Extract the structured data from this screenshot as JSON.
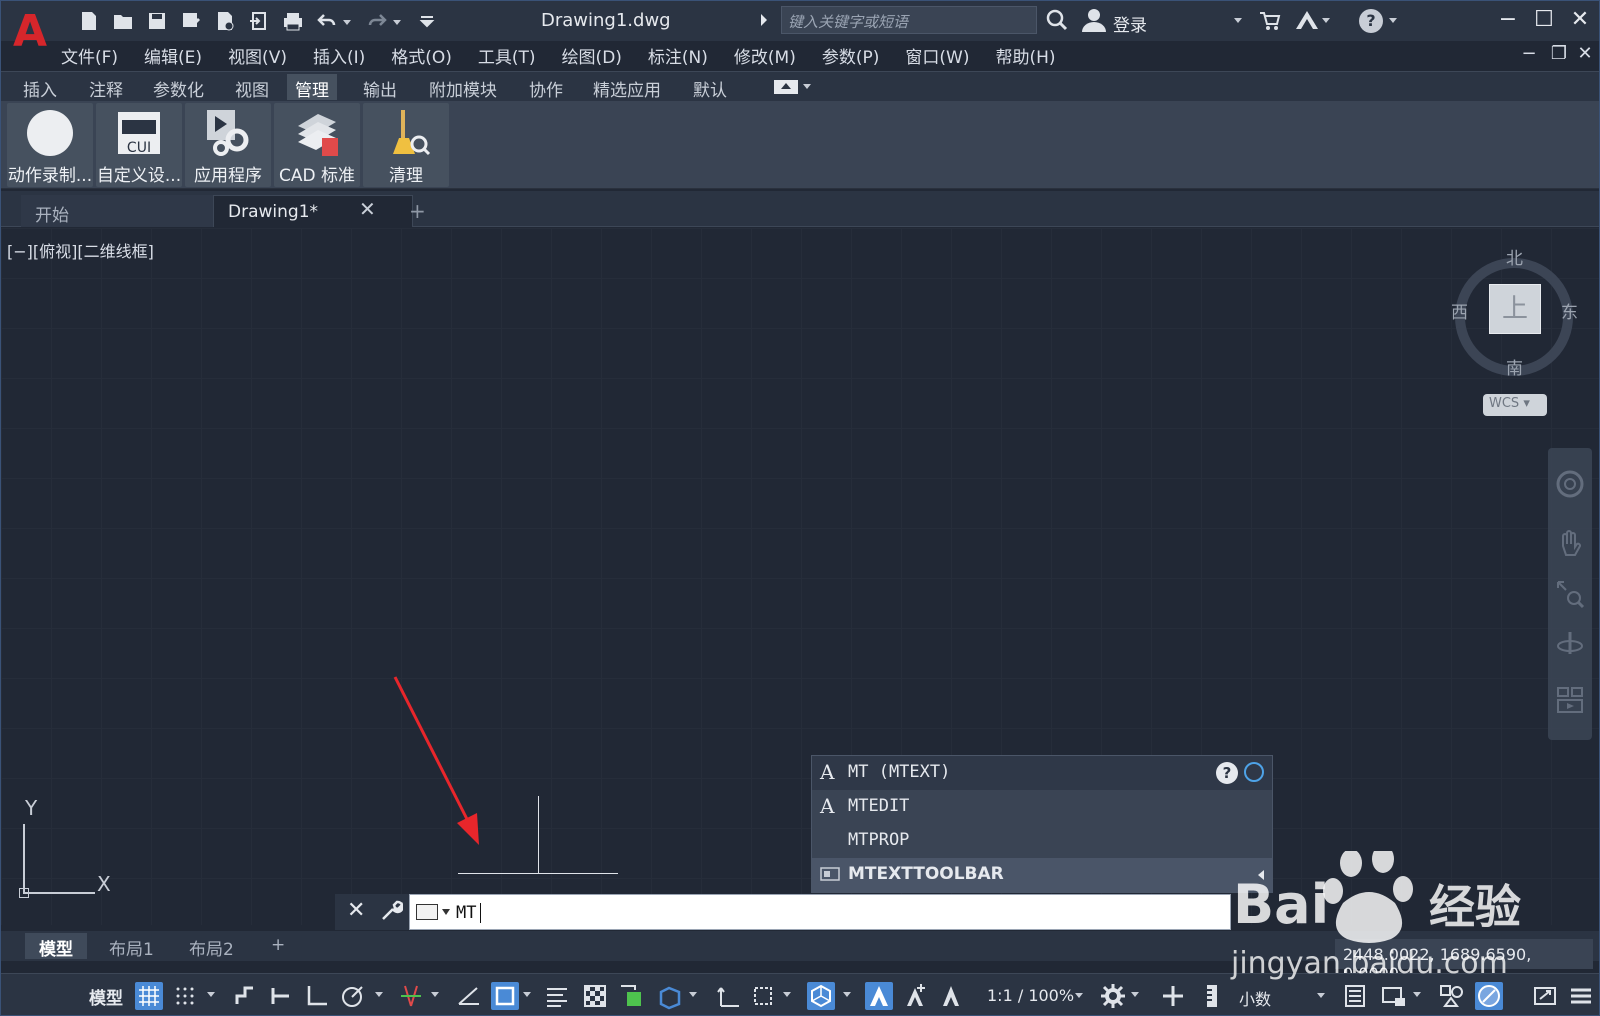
{
  "window": {
    "title": "Drawing1.dwg",
    "search_placeholder": "键入关键字或短语",
    "login_label": "登录",
    "logo_letter": "A"
  },
  "menu": [
    "文件(F)",
    "编辑(E)",
    "视图(V)",
    "插入(I)",
    "格式(O)",
    "工具(T)",
    "绘图(D)",
    "标注(N)",
    "修改(M)",
    "参数(P)",
    "窗口(W)",
    "帮助(H)"
  ],
  "ribbon_tabs": [
    {
      "label": "插入"
    },
    {
      "label": "注释"
    },
    {
      "label": "参数化"
    },
    {
      "label": "视图"
    },
    {
      "label": "管理",
      "active": true
    },
    {
      "label": "输出"
    },
    {
      "label": "附加模块"
    },
    {
      "label": "协作"
    },
    {
      "label": "精选应用"
    },
    {
      "label": "默认"
    }
  ],
  "ribbon_buttons": [
    {
      "label": "动作录制...",
      "icon": "record-icon"
    },
    {
      "label": "自定义设...",
      "icon": "cui-icon",
      "icon_text": "CUI"
    },
    {
      "label": "应用程序",
      "icon": "application-gear-icon"
    },
    {
      "label": "CAD 标准",
      "icon": "cad-standards-icon"
    },
    {
      "label": "清理",
      "icon": "purge-broom-icon"
    }
  ],
  "doc_tabs": {
    "start": "开始",
    "drawing": "Drawing1*"
  },
  "viewport_label": "[−][俯视][二维线框]",
  "viewcube": {
    "north": "北",
    "south": "南",
    "east": "东",
    "west": "西",
    "face": "上",
    "wcs": "WCS"
  },
  "ucs": {
    "x": "X",
    "y": "Y"
  },
  "autocomplete": [
    {
      "label": "MT (MTEXT)",
      "icon": "mtext-icon"
    },
    {
      "label": "MTEDIT",
      "icon": "mtedit-icon"
    },
    {
      "label": "MTPROP",
      "icon": ""
    },
    {
      "label": "MTEXTTOOLBAR",
      "icon": "toolbar-icon",
      "highlighted": true
    }
  ],
  "command_line": {
    "value": "MT"
  },
  "layout_tabs": [
    {
      "label": "模型",
      "active": true
    },
    {
      "label": "布局1"
    },
    {
      "label": "布局2"
    }
  ],
  "coordinates": "2448.0022, 1689.6590, 0.0000",
  "status": {
    "model": "模型",
    "scale": "1:1 / 100%",
    "units": "小数"
  },
  "watermark": {
    "brand_logo": "Bai du 经验",
    "url": "jingyan.baidu.com"
  },
  "colors": {
    "accent": "#4a8ad6",
    "logo_red": "#d6262b",
    "arrow_red": "#e8262b",
    "background": "#212835"
  }
}
